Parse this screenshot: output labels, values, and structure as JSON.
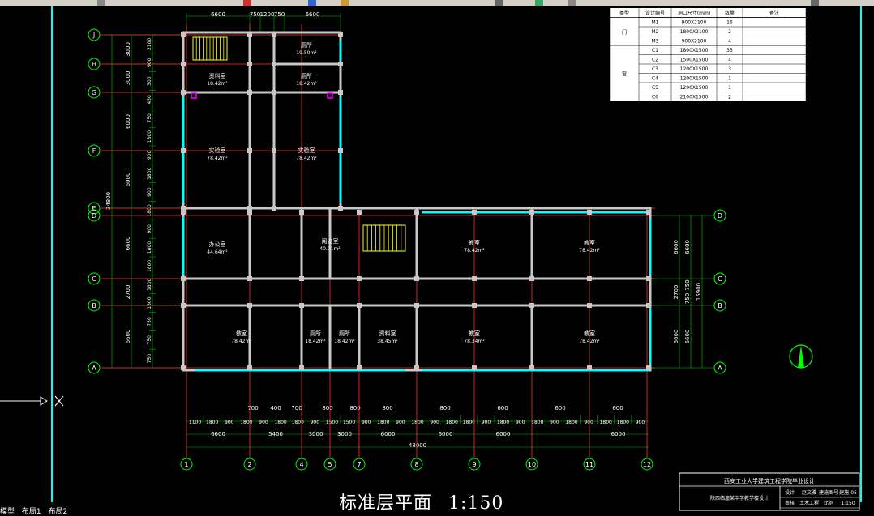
{
  "colors": {
    "background": "#000000",
    "wall": "#c8c8c8",
    "axis": "#ff3030",
    "dimension": "#00c800",
    "window": "#00ffff",
    "bubble": "#00ff00",
    "text": "#ffffff",
    "stair": "#ffff00",
    "magenta": "#ff00ff"
  },
  "title": {
    "main": "标准层平面",
    "scale": "1:150"
  },
  "axes": {
    "horizontal_left": [
      "J",
      "H",
      "G",
      "F",
      "E",
      "D",
      "C",
      "B",
      "A"
    ],
    "horizontal_right": [
      "D",
      "C",
      "B",
      "A"
    ],
    "vertical": [
      "1",
      "2",
      "4",
      "5",
      "7",
      "8",
      "9",
      "10",
      "11",
      "12"
    ]
  },
  "top_dims": [
    "6600",
    "750",
    "1200",
    "750",
    "6600"
  ],
  "left_dims": {
    "outer": [
      "3000",
      "3000",
      "6000",
      "6000",
      "6600",
      "2700",
      "6600"
    ],
    "total": "34800",
    "inner": [
      "2100",
      "900",
      "300",
      "450",
      "750",
      "1800",
      "900",
      "1800",
      "900",
      "1800",
      "900",
      "1800",
      "1800",
      "1800",
      "1800",
      "750",
      "750",
      "750"
    ]
  },
  "right_dims": {
    "outer": [
      "6600",
      "2700",
      "6600"
    ],
    "inner": [
      "6600",
      "750",
      "750",
      "6600"
    ],
    "total": "15900"
  },
  "bottom_dims": {
    "small": [
      "700",
      "400",
      "700",
      "800",
      "800",
      "800",
      "800",
      "600",
      "600",
      "600"
    ],
    "chain": [
      "1100",
      "1800",
      "900",
      "1800",
      "900",
      "1800",
      "1800",
      "900",
      "1500",
      "1500",
      "900",
      "1800",
      "900",
      "1800",
      "900",
      "1800",
      "1800",
      "900",
      "1800",
      "900",
      "1800",
      "900",
      "1800",
      "900",
      "1800",
      "1800",
      "900"
    ],
    "bays": [
      "6600",
      "5400",
      "3000",
      "3000",
      "6000",
      "6000",
      "6000",
      "6000"
    ],
    "total": "48000"
  },
  "rooms": [
    {
      "name": "厕所",
      "area": "19.50m²"
    },
    {
      "name": "资料室",
      "area": "18.42m²"
    },
    {
      "name": "厕所",
      "area": "18.42m²"
    },
    {
      "name": "实验室",
      "area": "78.42m²"
    },
    {
      "name": "实验室",
      "area": "78.42m²"
    },
    {
      "name": "办公室",
      "area": "44.64m²"
    },
    {
      "name": "阅览室",
      "area": "40.01m²"
    },
    {
      "name": "教室",
      "area": "78.42m²"
    },
    {
      "name": "教室",
      "area": "78.42m²"
    },
    {
      "name": "教室",
      "area": "78.42m²"
    },
    {
      "name": "厕所",
      "area": "18.42m²"
    },
    {
      "name": "厕所",
      "area": "18.42m²"
    },
    {
      "name": "资料室",
      "area": "38.45m²"
    },
    {
      "name": "教室",
      "area": "78.34m²"
    },
    {
      "name": "教室",
      "area": "78.42m²"
    }
  ],
  "door_schedule": {
    "headers": [
      "类型",
      "设计编号",
      "洞口尺寸(mm)",
      "数量",
      "备注"
    ],
    "groups": [
      {
        "type": "门",
        "rows": [
          [
            "M1",
            "900X2100",
            "16"
          ],
          [
            "M2",
            "1800X2100",
            "2"
          ],
          [
            "M3",
            "900X2100",
            "4"
          ]
        ]
      },
      {
        "type": "窗",
        "rows": [
          [
            "C1",
            "1800X1500",
            "33"
          ],
          [
            "C2",
            "1500X1500",
            "4"
          ],
          [
            "C3",
            "1200X1500",
            "3"
          ],
          [
            "C4",
            "1200X1500",
            "1"
          ],
          [
            "C5",
            "1200X1500",
            "1"
          ],
          [
            "C6",
            "2100X1500",
            "2"
          ]
        ]
      }
    ]
  },
  "title_block": {
    "school": "西安工业大学建筑工程学院毕业设计",
    "project": "陕西临潼某中学教学楼设计",
    "rows": [
      [
        "设计",
        "赵文雅",
        "建施图号",
        "建施-05"
      ],
      [
        "审核",
        "土木工程",
        "比例",
        "1:150"
      ]
    ]
  },
  "command_tabs": [
    "模型",
    "布局1",
    "布局2"
  ],
  "icons": [
    "north-arrow-icon",
    "ucs-icon"
  ]
}
